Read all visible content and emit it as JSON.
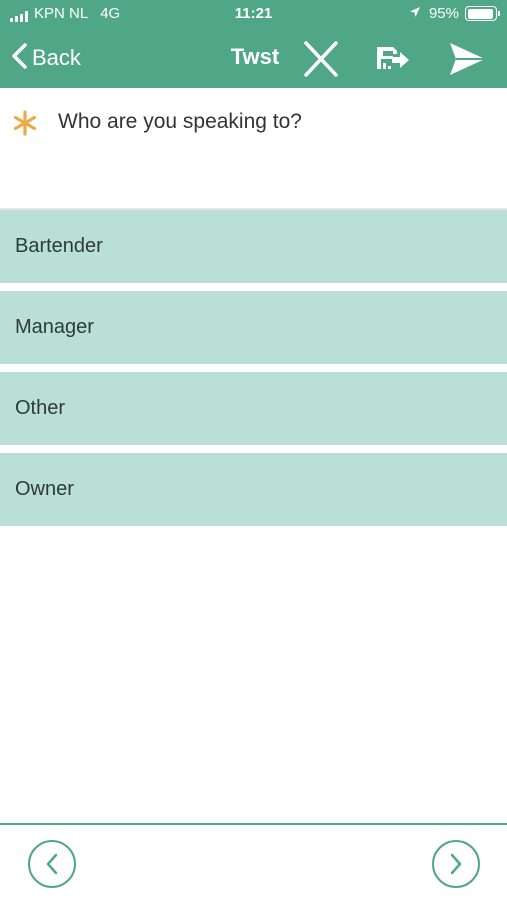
{
  "status_bar": {
    "carrier": "KPN NL",
    "network": "4G",
    "time": "11:21",
    "battery_percent": "95%",
    "battery_level": 0.95,
    "signal_bars": 4,
    "location_icon": "location-arrow-icon"
  },
  "nav": {
    "back_label": "Back",
    "title": "Twst",
    "icons": [
      "chevron-left-icon",
      "close-icon",
      "save-icon",
      "send-icon"
    ]
  },
  "question": {
    "required_icon": "asterisk-icon",
    "text": "Who are you speaking to?"
  },
  "options": [
    {
      "label": "Bartender"
    },
    {
      "label": "Manager"
    },
    {
      "label": "Other"
    },
    {
      "label": "Owner"
    }
  ],
  "footer": {
    "icons": [
      "chevron-left-icon",
      "chevron-right-icon"
    ]
  },
  "colors": {
    "header": "#4fa787",
    "option_bg": "#badfd4",
    "accent": "#4fa787",
    "required": "#f0a94a"
  }
}
